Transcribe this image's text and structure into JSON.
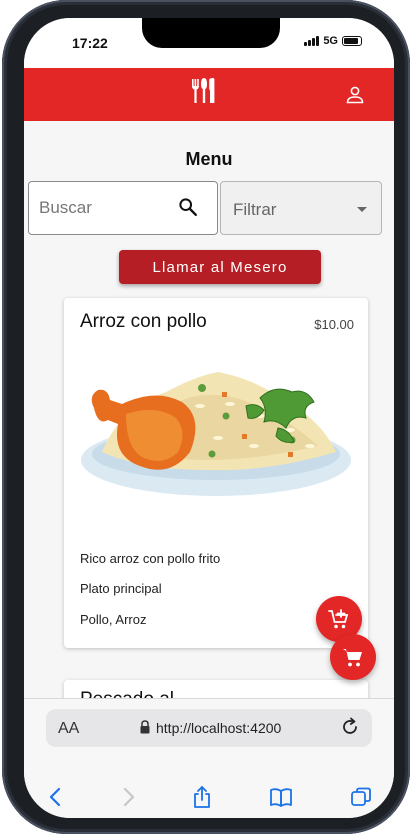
{
  "status_bar": {
    "time": "17:22",
    "network": "5G"
  },
  "app_bar": {
    "brand_color": "#e32626"
  },
  "page": {
    "title": "Menu"
  },
  "search": {
    "placeholder": "Buscar",
    "value": ""
  },
  "filter": {
    "label": "Filtrar"
  },
  "call_waiter": {
    "label": "Llamar al Mesero",
    "color": "#b41e24"
  },
  "menu_items": [
    {
      "name": "Arroz con pollo",
      "price": "$10.00",
      "description": "Rico arroz con pollo frito",
      "category": "Plato principal",
      "ingredients": "Pollo, Arroz"
    },
    {
      "name": "Pescado al..."
    }
  ],
  "browser": {
    "text_size_label": "AA",
    "url": "http://localhost:4200"
  },
  "icons": {
    "logo": "utensils-icon",
    "user": "user-icon",
    "search": "search-icon",
    "filter": "chevron-down-icon",
    "add_to_cart": "add-shopping-cart-icon",
    "cart": "shopping-cart-icon",
    "lock": "lock-icon",
    "reload": "reload-icon",
    "back": "back-icon",
    "forward": "forward-icon",
    "share": "share-icon",
    "bookmarks": "bookmarks-icon",
    "tabs": "tabs-icon"
  }
}
